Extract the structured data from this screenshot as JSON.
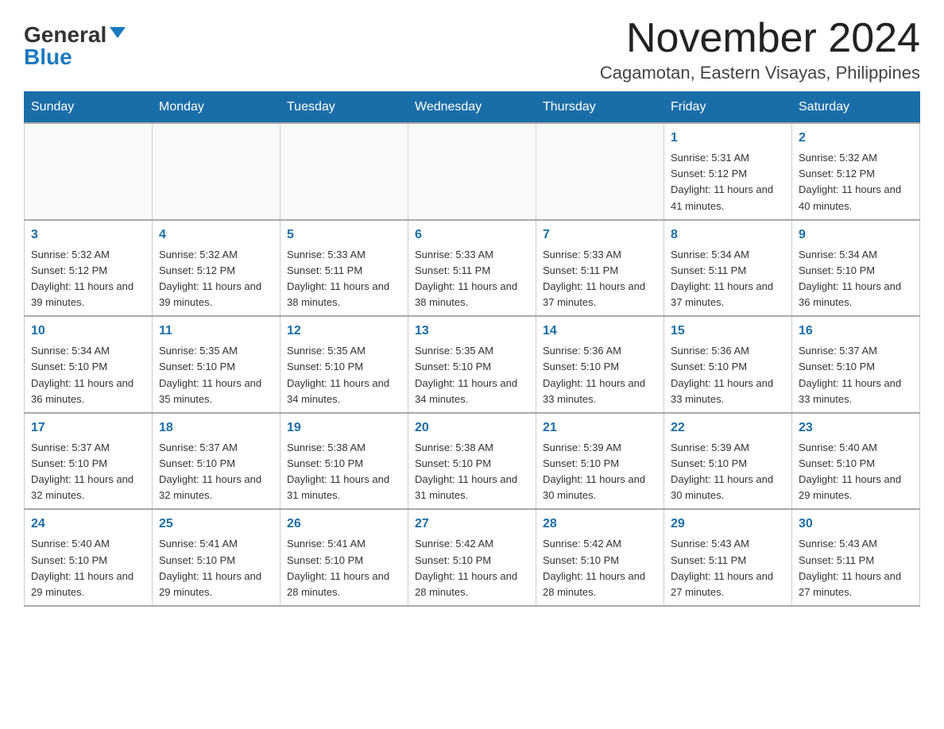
{
  "logo": {
    "general": "General",
    "blue": "Blue"
  },
  "title": "November 2024",
  "location": "Cagamotan, Eastern Visayas, Philippines",
  "days_of_week": [
    "Sunday",
    "Monday",
    "Tuesday",
    "Wednesday",
    "Thursday",
    "Friday",
    "Saturday"
  ],
  "weeks": [
    [
      {
        "day": "",
        "info": ""
      },
      {
        "day": "",
        "info": ""
      },
      {
        "day": "",
        "info": ""
      },
      {
        "day": "",
        "info": ""
      },
      {
        "day": "",
        "info": ""
      },
      {
        "day": "1",
        "info": "Sunrise: 5:31 AM\nSunset: 5:12 PM\nDaylight: 11 hours and 41 minutes."
      },
      {
        "day": "2",
        "info": "Sunrise: 5:32 AM\nSunset: 5:12 PM\nDaylight: 11 hours and 40 minutes."
      }
    ],
    [
      {
        "day": "3",
        "info": "Sunrise: 5:32 AM\nSunset: 5:12 PM\nDaylight: 11 hours and 39 minutes."
      },
      {
        "day": "4",
        "info": "Sunrise: 5:32 AM\nSunset: 5:12 PM\nDaylight: 11 hours and 39 minutes."
      },
      {
        "day": "5",
        "info": "Sunrise: 5:33 AM\nSunset: 5:11 PM\nDaylight: 11 hours and 38 minutes."
      },
      {
        "day": "6",
        "info": "Sunrise: 5:33 AM\nSunset: 5:11 PM\nDaylight: 11 hours and 38 minutes."
      },
      {
        "day": "7",
        "info": "Sunrise: 5:33 AM\nSunset: 5:11 PM\nDaylight: 11 hours and 37 minutes."
      },
      {
        "day": "8",
        "info": "Sunrise: 5:34 AM\nSunset: 5:11 PM\nDaylight: 11 hours and 37 minutes."
      },
      {
        "day": "9",
        "info": "Sunrise: 5:34 AM\nSunset: 5:10 PM\nDaylight: 11 hours and 36 minutes."
      }
    ],
    [
      {
        "day": "10",
        "info": "Sunrise: 5:34 AM\nSunset: 5:10 PM\nDaylight: 11 hours and 36 minutes."
      },
      {
        "day": "11",
        "info": "Sunrise: 5:35 AM\nSunset: 5:10 PM\nDaylight: 11 hours and 35 minutes."
      },
      {
        "day": "12",
        "info": "Sunrise: 5:35 AM\nSunset: 5:10 PM\nDaylight: 11 hours and 34 minutes."
      },
      {
        "day": "13",
        "info": "Sunrise: 5:35 AM\nSunset: 5:10 PM\nDaylight: 11 hours and 34 minutes."
      },
      {
        "day": "14",
        "info": "Sunrise: 5:36 AM\nSunset: 5:10 PM\nDaylight: 11 hours and 33 minutes."
      },
      {
        "day": "15",
        "info": "Sunrise: 5:36 AM\nSunset: 5:10 PM\nDaylight: 11 hours and 33 minutes."
      },
      {
        "day": "16",
        "info": "Sunrise: 5:37 AM\nSunset: 5:10 PM\nDaylight: 11 hours and 33 minutes."
      }
    ],
    [
      {
        "day": "17",
        "info": "Sunrise: 5:37 AM\nSunset: 5:10 PM\nDaylight: 11 hours and 32 minutes."
      },
      {
        "day": "18",
        "info": "Sunrise: 5:37 AM\nSunset: 5:10 PM\nDaylight: 11 hours and 32 minutes."
      },
      {
        "day": "19",
        "info": "Sunrise: 5:38 AM\nSunset: 5:10 PM\nDaylight: 11 hours and 31 minutes."
      },
      {
        "day": "20",
        "info": "Sunrise: 5:38 AM\nSunset: 5:10 PM\nDaylight: 11 hours and 31 minutes."
      },
      {
        "day": "21",
        "info": "Sunrise: 5:39 AM\nSunset: 5:10 PM\nDaylight: 11 hours and 30 minutes."
      },
      {
        "day": "22",
        "info": "Sunrise: 5:39 AM\nSunset: 5:10 PM\nDaylight: 11 hours and 30 minutes."
      },
      {
        "day": "23",
        "info": "Sunrise: 5:40 AM\nSunset: 5:10 PM\nDaylight: 11 hours and 29 minutes."
      }
    ],
    [
      {
        "day": "24",
        "info": "Sunrise: 5:40 AM\nSunset: 5:10 PM\nDaylight: 11 hours and 29 minutes."
      },
      {
        "day": "25",
        "info": "Sunrise: 5:41 AM\nSunset: 5:10 PM\nDaylight: 11 hours and 29 minutes."
      },
      {
        "day": "26",
        "info": "Sunrise: 5:41 AM\nSunset: 5:10 PM\nDaylight: 11 hours and 28 minutes."
      },
      {
        "day": "27",
        "info": "Sunrise: 5:42 AM\nSunset: 5:10 PM\nDaylight: 11 hours and 28 minutes."
      },
      {
        "day": "28",
        "info": "Sunrise: 5:42 AM\nSunset: 5:10 PM\nDaylight: 11 hours and 28 minutes."
      },
      {
        "day": "29",
        "info": "Sunrise: 5:43 AM\nSunset: 5:11 PM\nDaylight: 11 hours and 27 minutes."
      },
      {
        "day": "30",
        "info": "Sunrise: 5:43 AM\nSunset: 5:11 PM\nDaylight: 11 hours and 27 minutes."
      }
    ]
  ]
}
